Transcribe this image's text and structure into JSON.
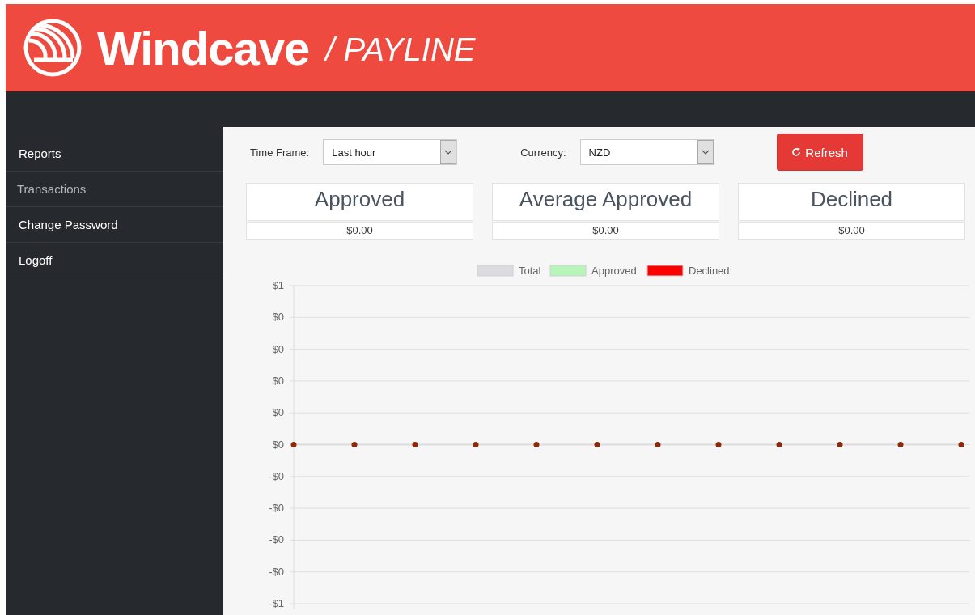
{
  "header": {
    "brand": "Windcave",
    "product": "/ PAYLINE"
  },
  "sidebar": {
    "items": [
      {
        "label": "Reports",
        "selected": false
      },
      {
        "label": "Transactions",
        "selected": true
      },
      {
        "label": "Change Password",
        "selected": false
      },
      {
        "label": "Logoff",
        "selected": false
      }
    ]
  },
  "filters": [
    {
      "label": "Time Frame:",
      "value": "Last hour"
    },
    {
      "label": "Currency:",
      "value": "NZD"
    }
  ],
  "refresh_button": {
    "label": "Refresh"
  },
  "summary_cards": [
    {
      "title": "Approved",
      "value": "$0.00"
    },
    {
      "title": "Average Approved",
      "value": "$0.00"
    },
    {
      "title": "Declined",
      "value": "$0.00"
    }
  ],
  "chart": {
    "y_axis_minor_labels": [
      "$0",
      "$0",
      "$0",
      "$0",
      "-$0",
      "-$0",
      "-$0",
      "-$0"
    ],
    "chart_data": {
      "type": "line",
      "ylim": [
        -1,
        1
      ],
      "yticks": [
        {
          "value": 1,
          "label": "$1"
        },
        {
          "value": 0,
          "label": "$0"
        },
        {
          "value": -1,
          "label": "-$1"
        }
      ],
      "series": [
        {
          "name": "Total",
          "color": "#dcdce0",
          "marker": "circle",
          "values": [
            0,
            0,
            0,
            0,
            0,
            0,
            0,
            0,
            0,
            0,
            0,
            0
          ]
        },
        {
          "name": "Approved",
          "color": "#b8f5b8",
          "values": [
            null,
            null,
            null,
            null,
            null,
            null,
            null,
            null,
            null,
            null,
            null,
            null
          ]
        },
        {
          "name": "Declined",
          "color": "#ff0000",
          "values": [
            null,
            null,
            null,
            null,
            null,
            null,
            null,
            null,
            null,
            null,
            null,
            null
          ]
        }
      ]
    }
  }
}
